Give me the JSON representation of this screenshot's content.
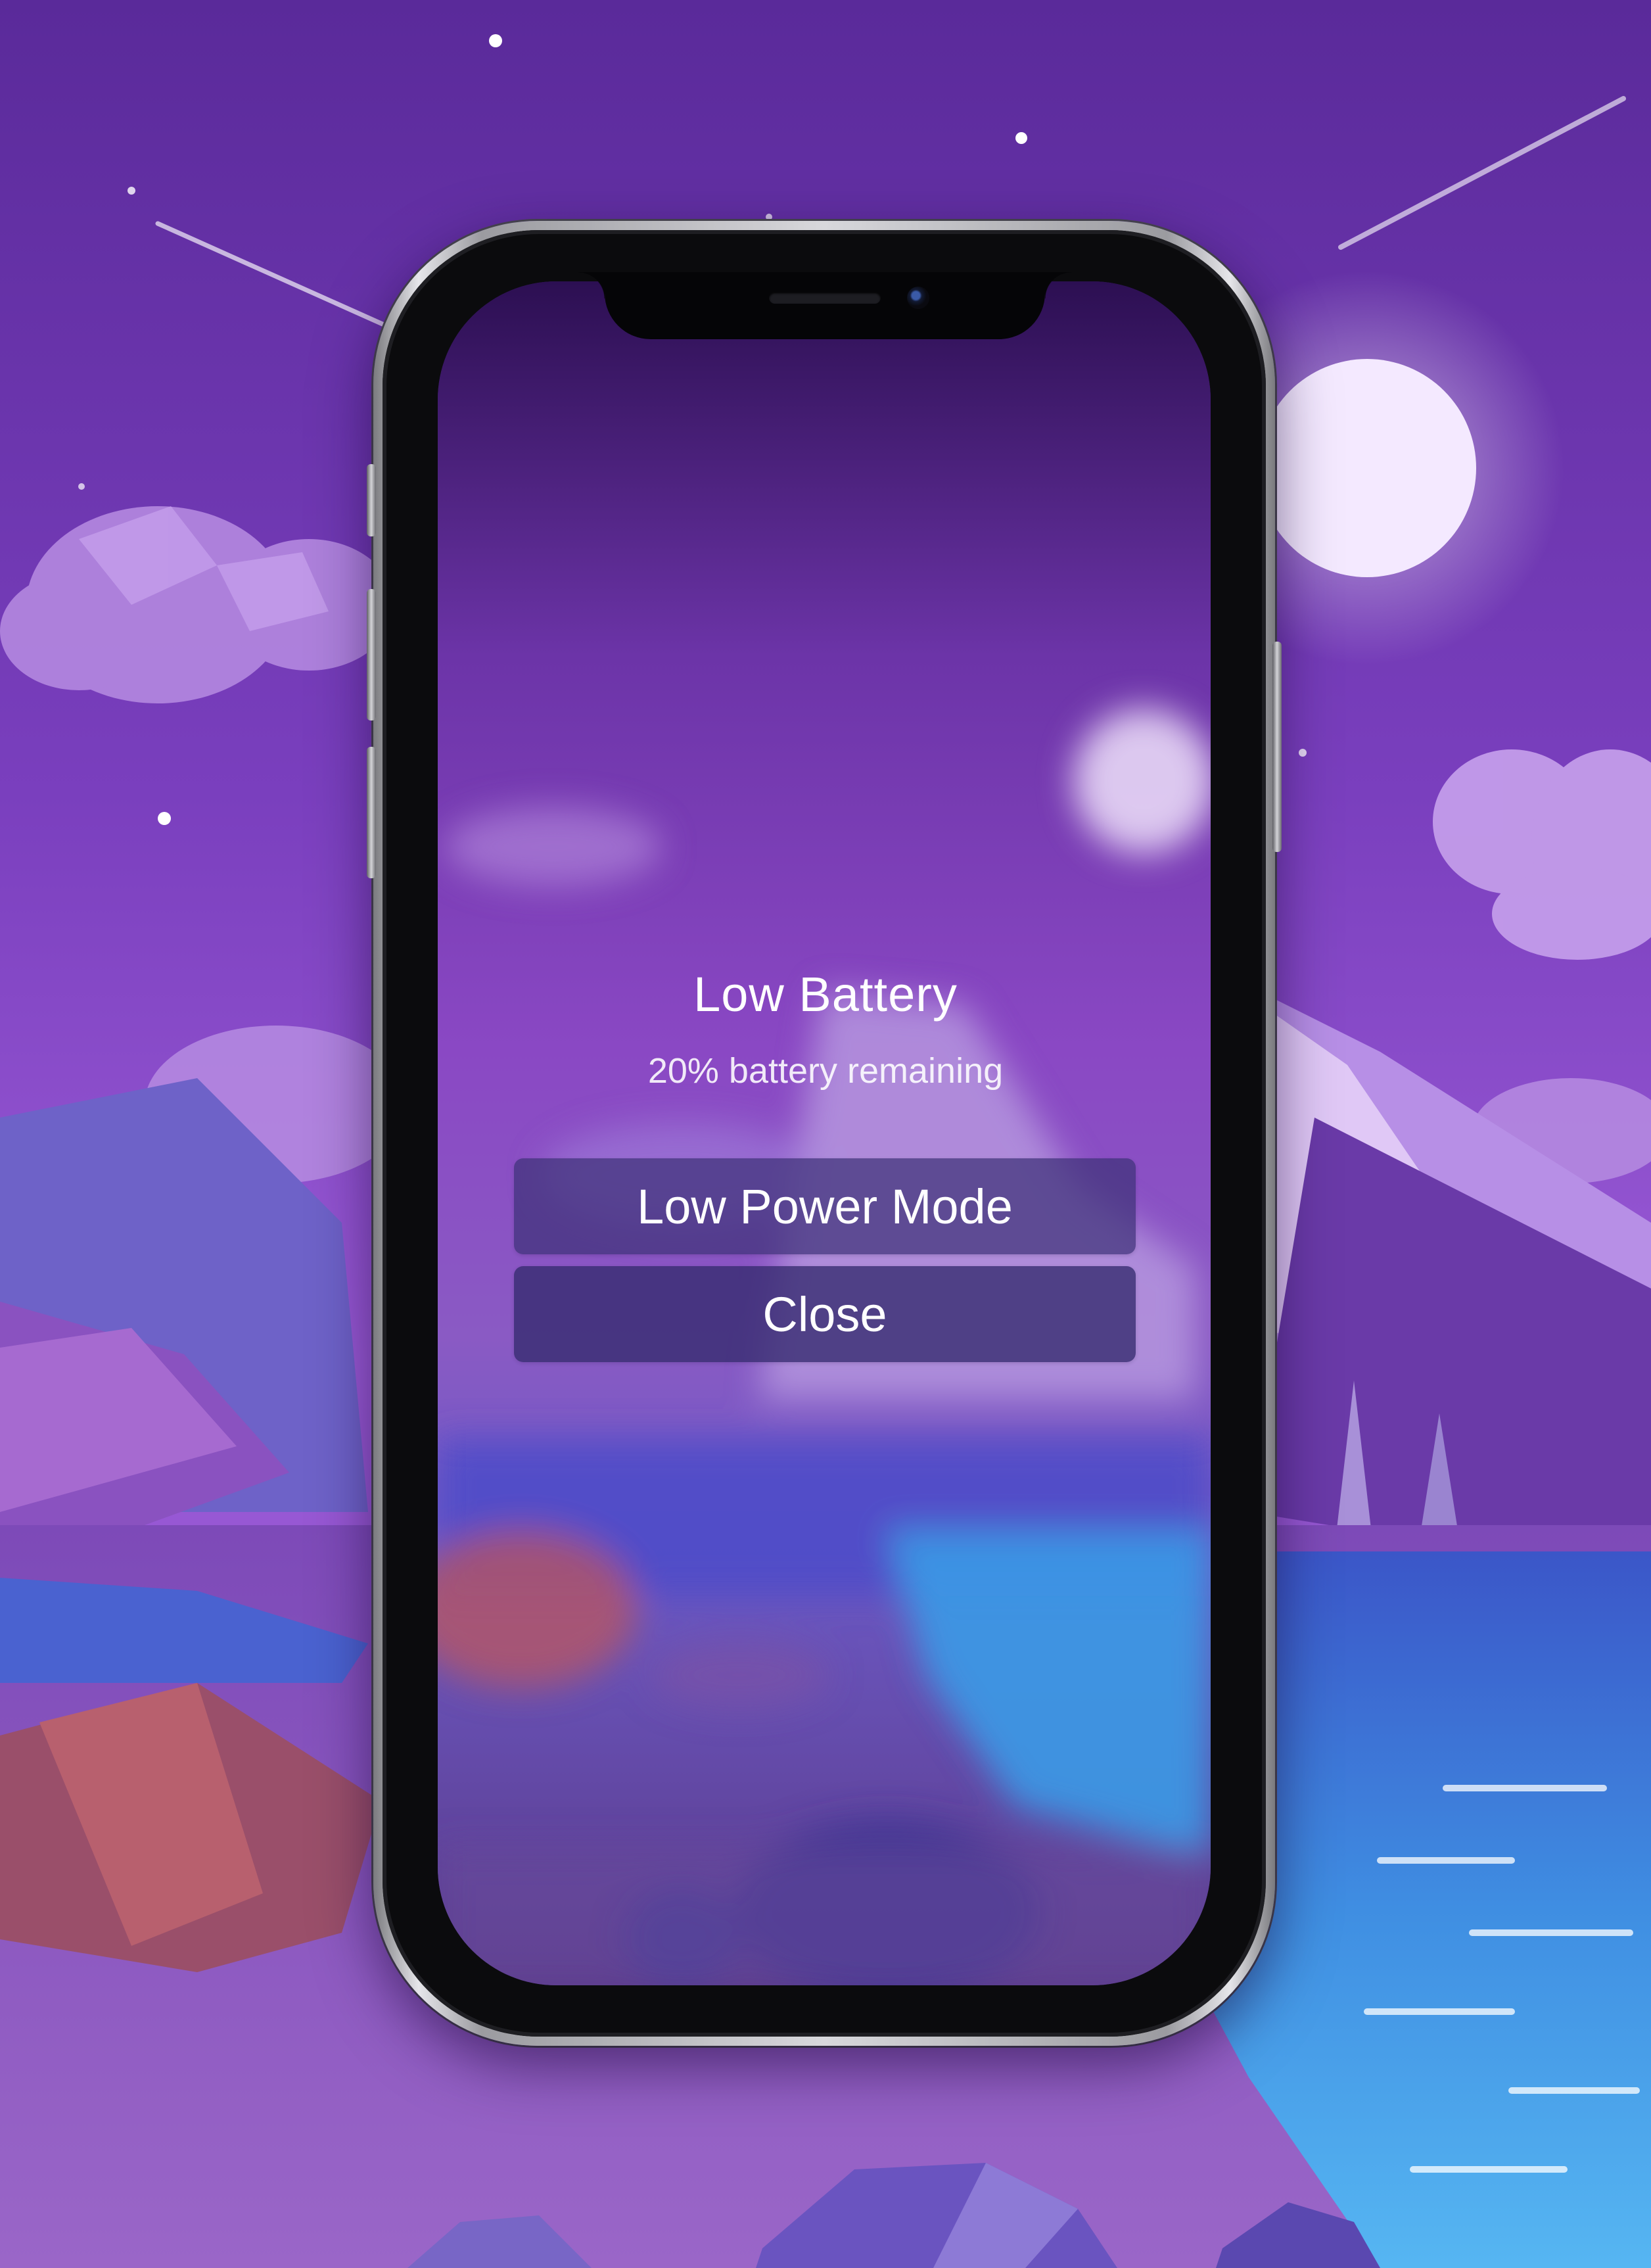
{
  "alert": {
    "title": "Low Battery",
    "message": "20% battery remaining",
    "buttons": [
      {
        "label": "Low Power Mode"
      },
      {
        "label": "Close"
      }
    ]
  },
  "colors": {
    "sky_top": "#5a2a9a",
    "sky_mid": "#8a4ed0",
    "moon": "#f4e9ff",
    "water": "#3aa2ea",
    "mountain": "#7c4ec0",
    "button_fill": "#3e3278"
  }
}
